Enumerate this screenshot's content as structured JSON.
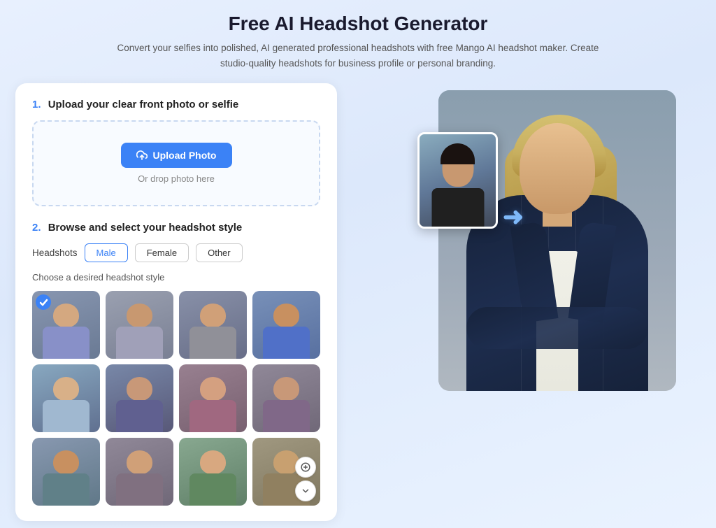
{
  "header": {
    "title": "Free AI Headshot Generator",
    "subtitle": "Convert your selfies into polished, AI generated professional headshots with free Mango AI headshot maker. Create studio-quality headshots for business profile or personal branding."
  },
  "step1": {
    "label": "1.",
    "title": "Upload your clear front photo or selfie",
    "upload_button": "Upload Photo",
    "drop_text": "Or drop photo here"
  },
  "step2": {
    "label": "2.",
    "title": "Browse and select your headshot style",
    "filter_label": "Headshots",
    "filters": [
      "Male",
      "Female",
      "Other"
    ],
    "active_filter": "Male",
    "choose_label": "Choose a desired headshot style"
  },
  "headshot_styles": [
    {
      "id": 1,
      "selected": true
    },
    {
      "id": 2,
      "selected": false
    },
    {
      "id": 3,
      "selected": false
    },
    {
      "id": 4,
      "selected": false
    },
    {
      "id": 5,
      "selected": false
    },
    {
      "id": 6,
      "selected": false
    },
    {
      "id": 7,
      "selected": false
    },
    {
      "id": 8,
      "selected": false
    },
    {
      "id": 9,
      "selected": false
    },
    {
      "id": 10,
      "selected": false
    },
    {
      "id": 11,
      "selected": false
    },
    {
      "id": 12,
      "selected": false
    }
  ],
  "colors": {
    "accent_blue": "#3b82f6",
    "bg_gradient_start": "#e8f0fe",
    "bg_gradient_end": "#eaf3ff"
  }
}
